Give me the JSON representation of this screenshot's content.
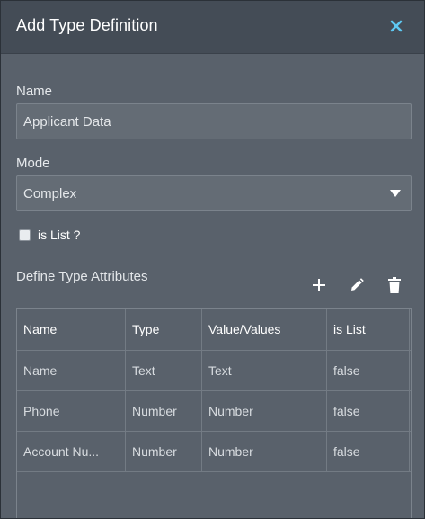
{
  "dialog": {
    "title": "Add Type Definition",
    "close_icon": "close-icon"
  },
  "form": {
    "name_label": "Name",
    "name_value": "Applicant Data",
    "mode_label": "Mode",
    "mode_value": "Complex",
    "is_list_label": "is List ?",
    "is_list_checked": false
  },
  "attributes": {
    "section_title": "Define Type Attributes",
    "toolbar_icons": [
      "plus-icon",
      "pencil-icon",
      "trash-icon"
    ],
    "columns": [
      "Name",
      "Type",
      "Value/Values",
      "is List"
    ],
    "rows": [
      [
        "Name",
        "Text",
        "Text",
        "false"
      ],
      [
        "Phone",
        "Number",
        "Number",
        "false"
      ],
      [
        "Account Nu...",
        "Number",
        "Number",
        "false"
      ]
    ]
  },
  "colors": {
    "body": "#59616b",
    "titlebar": "#444c56",
    "close_accent": "#5ec8f2"
  }
}
